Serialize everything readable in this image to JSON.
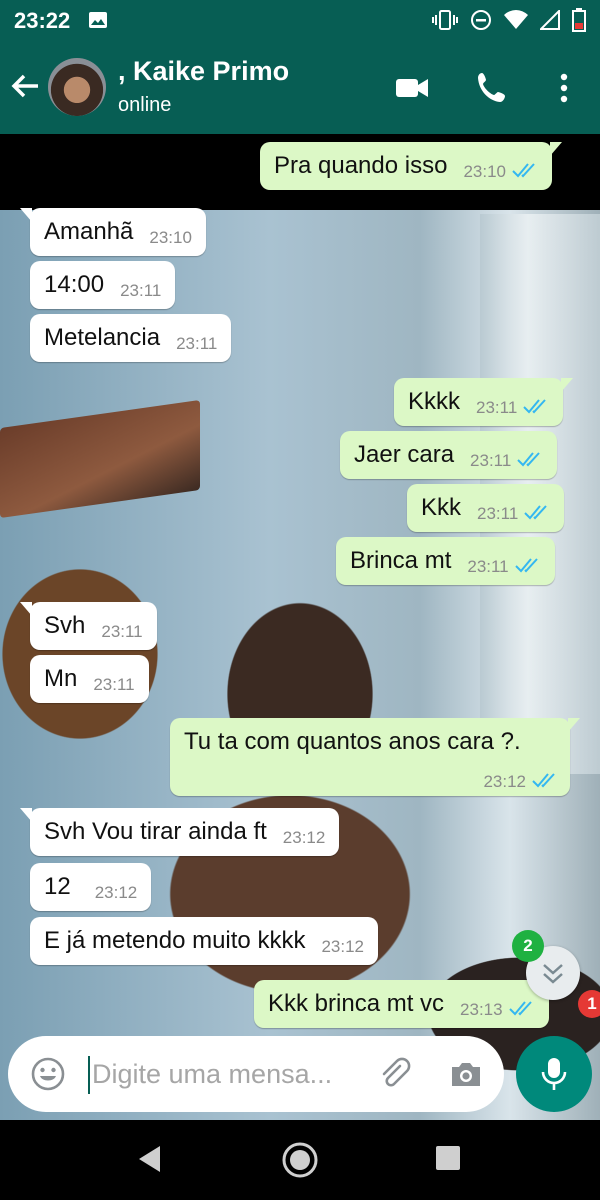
{
  "status_bar": {
    "time": "23:22",
    "icons": [
      "image-icon",
      "vibrate-icon",
      "do-not-disturb-icon",
      "wifi-icon",
      "signal-icon",
      "battery-icon"
    ]
  },
  "header": {
    "contact_name": ", Kaike Primo",
    "presence": "online",
    "actions": [
      "video-call-icon",
      "call-icon",
      "more-options-icon"
    ]
  },
  "messages": [
    {
      "direction": "out",
      "text": "Pra quando isso",
      "time": "23:10",
      "read": true
    },
    {
      "direction": "in",
      "text": "Amanhã",
      "time": "23:10"
    },
    {
      "direction": "in",
      "text": "14:00",
      "time": "23:11"
    },
    {
      "direction": "in",
      "text": "Metelancia",
      "time": "23:11"
    },
    {
      "direction": "out",
      "text": "Kkkk",
      "time": "23:11",
      "read": true
    },
    {
      "direction": "out",
      "text": "Jaer cara",
      "time": "23:11",
      "read": true
    },
    {
      "direction": "out",
      "text": "Kkk",
      "time": "23:11",
      "read": true
    },
    {
      "direction": "out",
      "text": "Brinca mt",
      "time": "23:11",
      "read": true
    },
    {
      "direction": "in",
      "text": "Svh",
      "time": "23:11"
    },
    {
      "direction": "in",
      "text": "Mn",
      "time": "23:11"
    },
    {
      "direction": "out",
      "text": "Tu ta com quantos anos cara ?.",
      "time": "23:12",
      "read": true
    },
    {
      "direction": "in",
      "text": "Svh Vou tirar ainda ft",
      "time": "23:12"
    },
    {
      "direction": "in",
      "text": "12",
      "time": "23:12"
    },
    {
      "direction": "in",
      "text": "E já metendo muito kkkk",
      "time": "23:12"
    },
    {
      "direction": "out",
      "text": "Kkk brinca mt vc",
      "time": "23:13",
      "read": true
    }
  ],
  "scroll_to_bottom": {
    "unread_badge": "2",
    "mention_badge": "1"
  },
  "composer": {
    "placeholder": "Digite uma mensa..."
  },
  "colors": {
    "header": "#075e54",
    "outgoing": "#dcf8c6",
    "incoming": "#ffffff",
    "read_ticks": "#34b7f1",
    "mic": "#00897b"
  }
}
